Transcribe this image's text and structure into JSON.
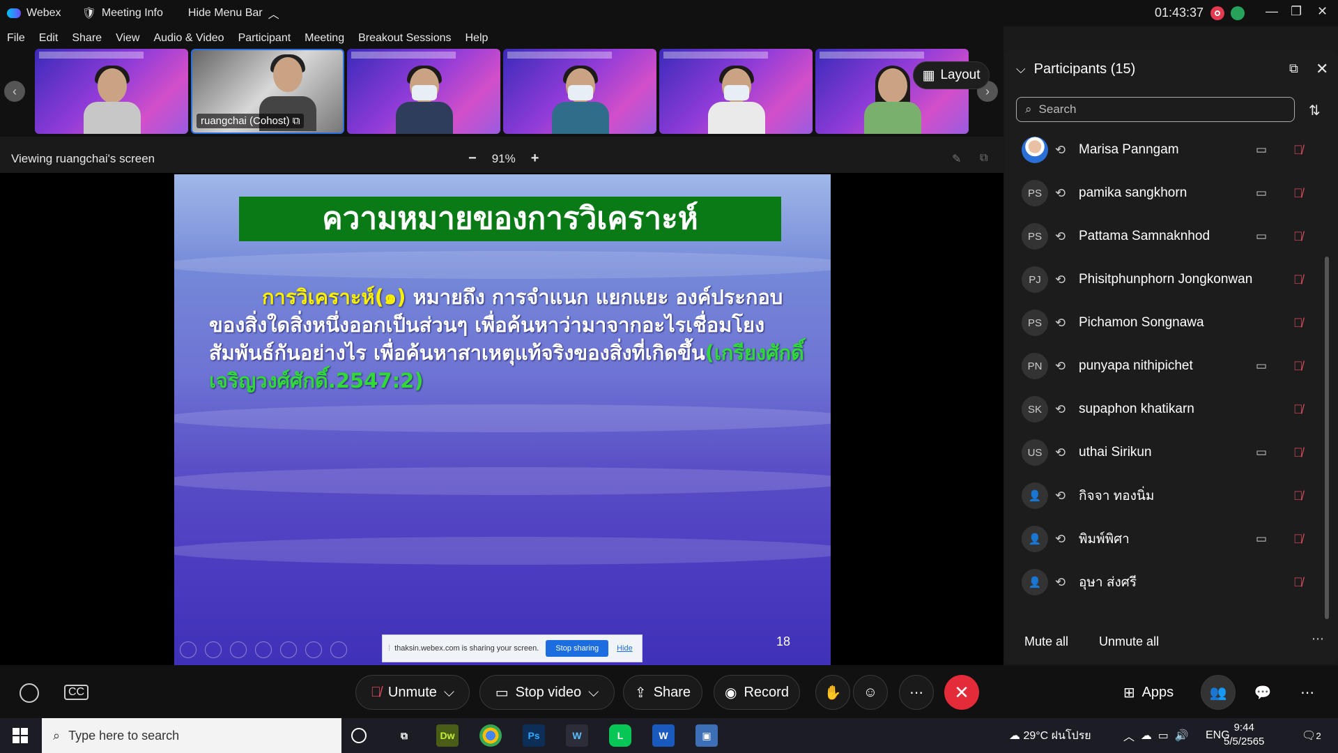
{
  "app": {
    "name": "Webex",
    "meeting_info": "Meeting Info",
    "hide_menu": "Hide Menu Bar",
    "clock": "01:43:37"
  },
  "menu": [
    "File",
    "Edit",
    "Share",
    "View",
    "Audio & Video",
    "Participant",
    "Meeting",
    "Breakout Sessions",
    "Help"
  ],
  "videos": {
    "active_name": "ruangchai (Cohost)",
    "layout_label": "Layout"
  },
  "view": {
    "status": "Viewing ruangchai's screen",
    "zoom": "91%",
    "minus": "−",
    "plus": "+"
  },
  "slide": {
    "title": "ความหมายของการวิเคราะห์",
    "term": "การวิเคราะห์(๑)",
    "body1": " หมายถึง  การจำแนก แยกแยะ องค์ประกอบของสิ่งใดสิ่งหนึ่งออกเป็นส่วนๆ    เพื่อค้นหาว่ามาจากอะไรเชื่อมโยงสัมพันธ์กันอย่างไร เพื่อค้นหาสาเหตุแท้จริงของสิ่งที่เกิดขึ้น",
    "citation": "(เกรียงศักดิ์ เจริญวงศ์ศักดิ์.2547:2)",
    "page": "18"
  },
  "share_notice": {
    "text": "thaksin.webex.com is sharing your screen.",
    "stop": "Stop sharing",
    "hide": "Hide"
  },
  "participants": {
    "header": "Participants (15)",
    "search_placeholder": "Search",
    "list": [
      {
        "initials": "",
        "name": "Marisa Panngam",
        "cam": true,
        "type": "photo"
      },
      {
        "initials": "PS",
        "name": "pamika sangkhorn",
        "cam": true
      },
      {
        "initials": "PS",
        "name": "Pattama Samnaknhod",
        "cam": true
      },
      {
        "initials": "PJ",
        "name": "Phisitphunphorn Jongkonwan",
        "cam": false
      },
      {
        "initials": "PS",
        "name": "Pichamon Songnawa",
        "cam": false
      },
      {
        "initials": "PN",
        "name": "punyapa nithipichet",
        "cam": true
      },
      {
        "initials": "SK",
        "name": "supaphon khatikarn",
        "cam": false
      },
      {
        "initials": "US",
        "name": "uthai Sirikun",
        "cam": true
      },
      {
        "initials": "",
        "name": "กิจจา ทองนิ่ม",
        "cam": false,
        "type": "person"
      },
      {
        "initials": "",
        "name": "พิมพ์พิศา",
        "cam": true,
        "type": "person"
      },
      {
        "initials": "",
        "name": "อุษา ส่งศรี",
        "cam": false,
        "type": "person"
      }
    ],
    "mute_all": "Mute all",
    "unmute_all": "Unmute all"
  },
  "controls": {
    "unmute": "Unmute",
    "stop_video": "Stop video",
    "share": "Share",
    "record": "Record",
    "apps": "Apps"
  },
  "taskbar": {
    "search_placeholder": "Type here to search",
    "weather": "29°C ฝนโปรย",
    "lang": "ENG",
    "time": "9:44",
    "date": "5/5/2565",
    "notif": "2"
  },
  "colors": {
    "accent": "#1c6de0",
    "end": "#e32b3a",
    "slide_title_bg": "#0a7a17"
  }
}
